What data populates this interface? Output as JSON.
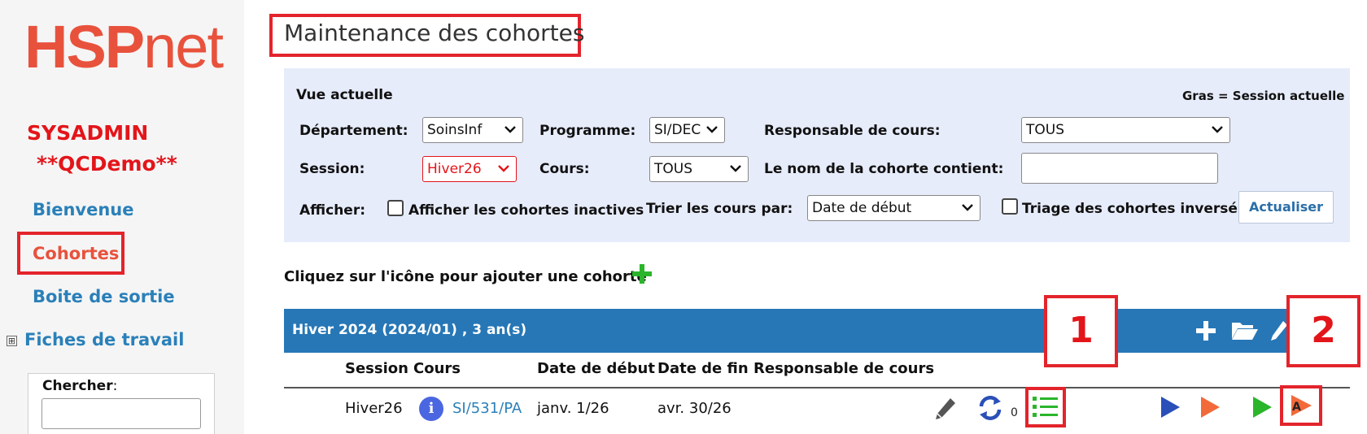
{
  "logo": {
    "text_bold": "HSP",
    "text_light": "net"
  },
  "user": {
    "role": "SYSADMIN",
    "database": "**QCDemo**"
  },
  "nav": {
    "welcome": "Bienvenue",
    "cohorts": "Cohortes",
    "outbox": "Boite de sortie",
    "worksheets": "Fiches de travail",
    "expand_symbol": "⊞"
  },
  "search": {
    "label": "Chercher",
    "colon": ":",
    "value": ""
  },
  "page_title": "Maintenance des cohortes",
  "filters": {
    "heading": "Vue actuelle",
    "legend_bold": "Gras",
    "legend_text": "= Session actuelle",
    "department_label": "Département:",
    "department_value": "SoinsInf",
    "program_label": "Programme:",
    "program_value": "SI/DEC",
    "course_lead_label": "Responsable de cours:",
    "course_lead_value": "TOUS",
    "session_label": "Session:",
    "session_value": "Hiver26",
    "course_label": "Cours:",
    "course_value": "TOUS",
    "name_contains_label": "Le nom de la cohorte contient:",
    "name_contains_value": "",
    "show_label": "Afficher:",
    "inactive_label": "Afficher les cohortes inactives",
    "sort_label": "Trier les cours par:",
    "sort_value": "Date de début",
    "reverse_label": "Triage des cohortes inversé",
    "update_button": "Actualiser"
  },
  "add_cohort_text": "Cliquez sur l'icône pour ajouter une cohorte",
  "cohort_group": {
    "title": "Hiver 2024 (2024/01) , 3 an(s)",
    "columns": [
      "Session",
      "Cours",
      "Date de début",
      "Date de fin",
      "Responsable de cours"
    ],
    "rows": [
      {
        "session": "Hiver26",
        "course": "SI/531/PA",
        "start": "janv. 1/26",
        "end": "avr. 30/26",
        "lead": "",
        "count": "0"
      }
    ]
  },
  "callouts": {
    "one": "1",
    "two": "2"
  },
  "colors": {
    "accent_red": "#e3242b",
    "header_blue": "#2777b6",
    "link_blue": "#2a80b9",
    "panel_bg": "#e7ecfb"
  }
}
